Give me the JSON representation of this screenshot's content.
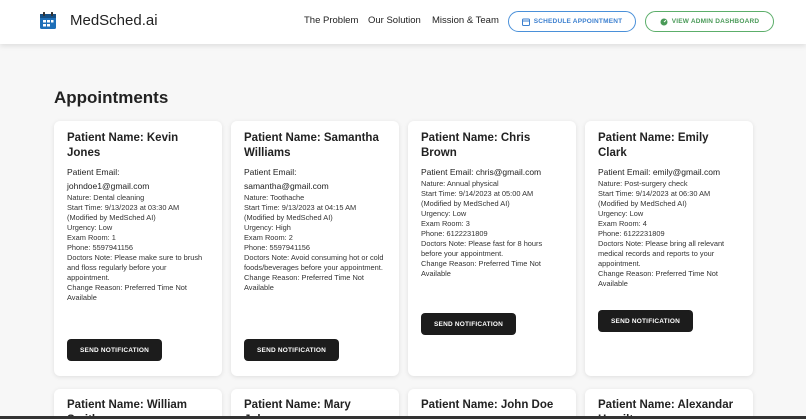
{
  "brand": {
    "name": "MedSched.ai",
    "icon": "calendar-icon",
    "icon_color": "#1e6fb8"
  },
  "nav": {
    "links": [
      "The Problem",
      "Our Solution",
      "Mission & Team"
    ],
    "schedule_button": "SCHEDULE APPOINTMENT",
    "admin_button": "VIEW ADMIN DASHBOARD"
  },
  "page": {
    "title": "Appointments"
  },
  "appointments": [
    {
      "name": "Patient Name: Kevin Jones",
      "email_label": "Patient Email:",
      "email": "johndoe1@gmail.com",
      "nature": "Nature: Dental cleaning",
      "start_time": "Start Time: 9/13/2023 at 03:30 AM (Modified by MedSched AI)",
      "urgency": "Urgency: Low",
      "exam_room": "Exam Room: 1",
      "phone": "Phone: 5597941156",
      "doctors_note": "Doctors Note: Please make sure to brush and floss regularly before your appointment.",
      "change_reason": "Change Reason: Preferred Time Not Available",
      "button": "SEND NOTIFICATION"
    },
    {
      "name": "Patient Name: Samantha Williams",
      "email_label": "Patient Email:",
      "email": "samantha@gmail.com",
      "nature": "Nature: Toothache",
      "start_time": "Start Time: 9/13/2023 at 04:15 AM (Modified by MedSched AI)",
      "urgency": "Urgency: High",
      "exam_room": "Exam Room: 2",
      "phone": "Phone: 5597941156",
      "doctors_note": "Doctors Note: Avoid consuming hot or cold foods/beverages before your appointment.",
      "change_reason": "Change Reason: Preferred Time Not Available",
      "button": "SEND NOTIFICATION"
    },
    {
      "name": "Patient Name: Chris Brown",
      "email_label": "Patient Email:",
      "email": "chris@gmail.com",
      "nature": "Nature: Annual physical",
      "start_time": "Start Time: 9/14/2023 at 05:00 AM (Modified by MedSched AI)",
      "urgency": "Urgency: Low",
      "exam_room": "Exam Room: 3",
      "phone": "Phone: 6122231809",
      "doctors_note": "Doctors Note: Please fast for 8 hours before your appointment.",
      "change_reason": "Change Reason: Preferred Time Not Available",
      "button": "SEND NOTIFICATION"
    },
    {
      "name": "Patient Name: Emily Clark",
      "email_label": "Patient Email:",
      "email": "emily@gmail.com",
      "nature": "Nature: Post-surgery check",
      "start_time": "Start Time: 9/14/2023 at 06:30 AM (Modified by MedSched AI)",
      "urgency": "Urgency: Low",
      "exam_room": "Exam Room: 4",
      "phone": "Phone: 6122231809",
      "doctors_note": "Doctors Note: Please bring all relevant medical records and reports to your appointment.",
      "change_reason": "Change Reason: Preferred Time Not Available",
      "button": "SEND NOTIFICATION"
    }
  ],
  "next_row": [
    {
      "name": "Patient Name: William Smith"
    },
    {
      "name": "Patient Name: Mary Johnson"
    },
    {
      "name": "Patient Name: John Doe"
    },
    {
      "name": "Patient Name: Alexandar Hamilton"
    }
  ]
}
